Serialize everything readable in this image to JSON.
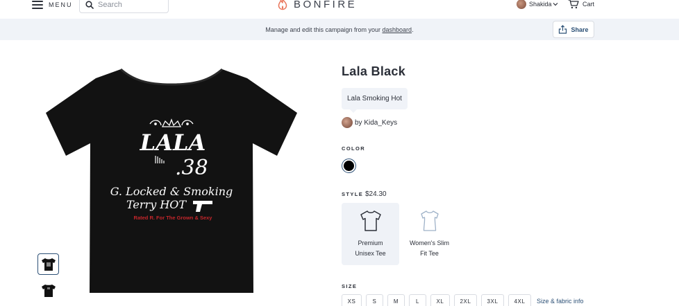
{
  "nav": {
    "menu_label": "MENU",
    "search_placeholder": "Search",
    "logo_text": "BONFIRE",
    "user_name": "Shakida",
    "cart_label": "Cart"
  },
  "banner": {
    "text_before": "Manage and edit this campaign from your ",
    "link_text": "dashboard",
    "text_after": ".",
    "share_label": "Share"
  },
  "shirt_print": {
    "line1": "LALA",
    "line2": ".38",
    "line3": "G. Locked & Smoking",
    "line4": "Terry HOT",
    "tagline": "Rated R. For The Grown & Sexy"
  },
  "product": {
    "title": "Lala Black",
    "subtitle": "Lala Smoking Hot",
    "byline": "by Kida_Keys",
    "color_label": "COLOR",
    "selected_color": "#000000",
    "style_label": "STYLE",
    "price": "$24.30",
    "styles": [
      {
        "line1": "Premium",
        "line2": "Unisex Tee"
      },
      {
        "line1": "Women's Slim",
        "line2": "Fit Tee"
      }
    ],
    "size_label": "SIZE",
    "sizes": [
      "XS",
      "S",
      "M",
      "L",
      "XL",
      "2XL",
      "3XL",
      "4XL"
    ],
    "size_info_link": "Size & fabric info"
  },
  "colors": {
    "accent": "#2b4f75",
    "logo_flame": "#e9765b",
    "banner_bg": "#f0f3f8",
    "print_red": "#c4262b"
  }
}
